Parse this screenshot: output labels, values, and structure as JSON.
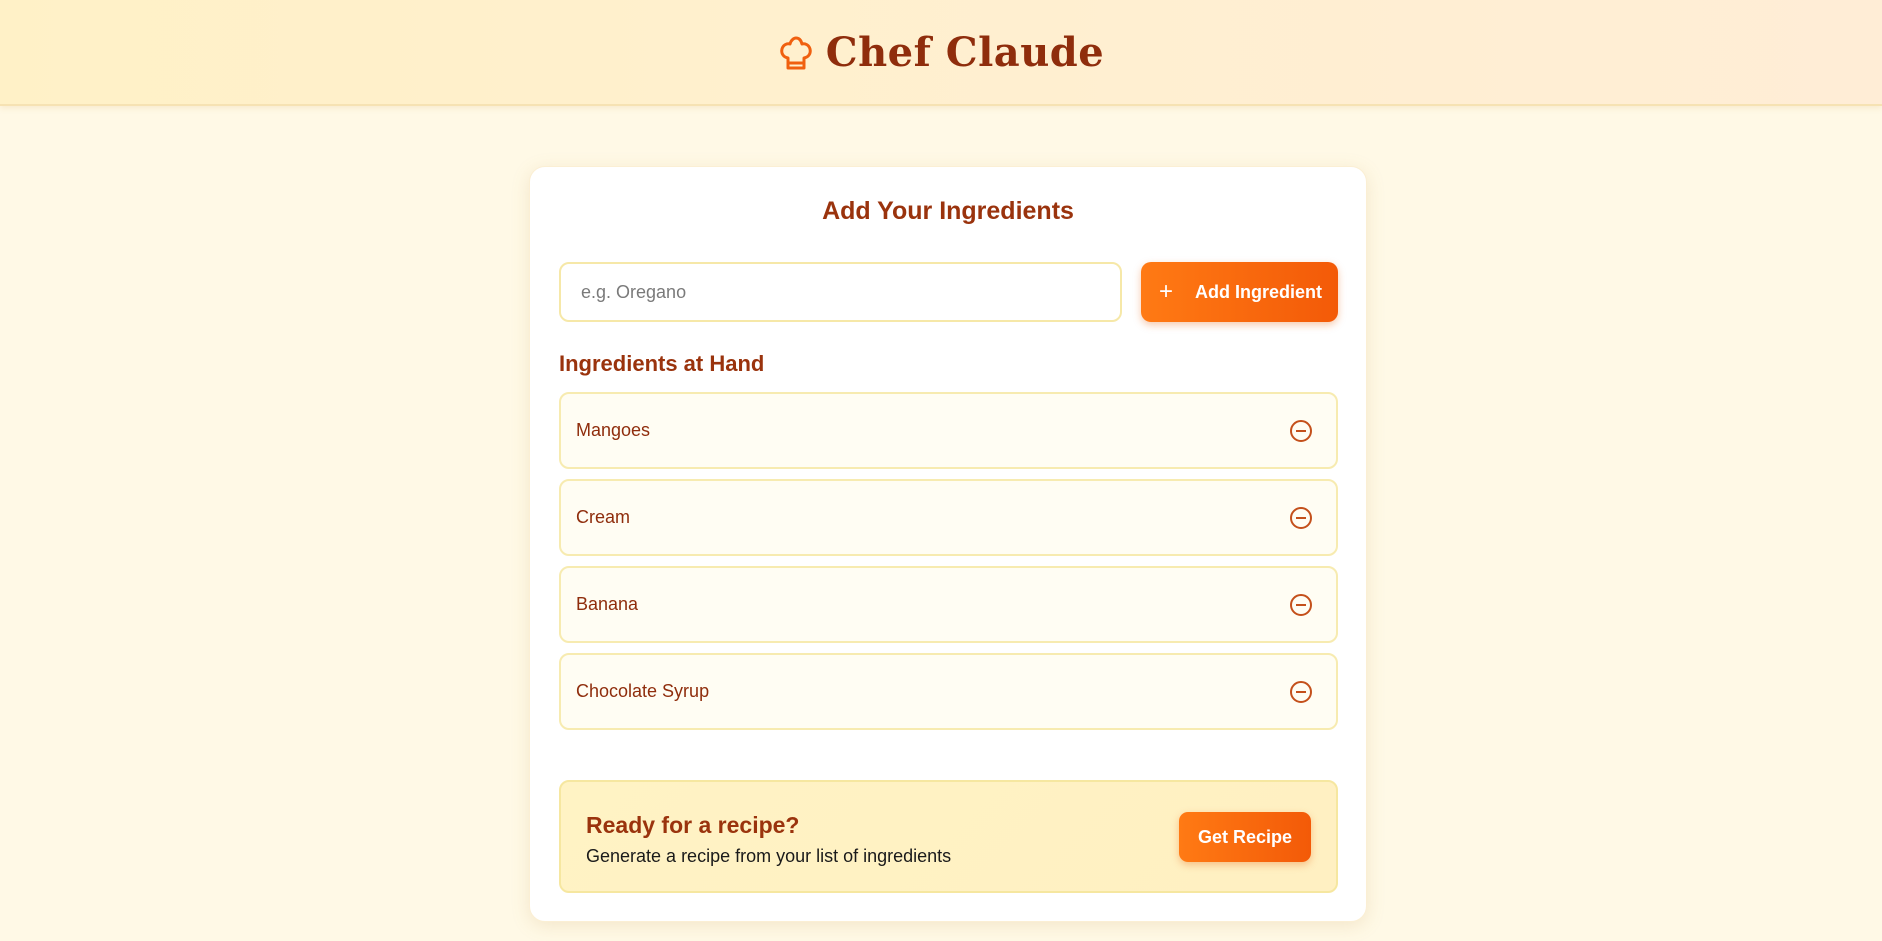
{
  "header": {
    "title": "Chef Claude",
    "icon": "chef-hat-icon"
  },
  "form": {
    "title": "Add Your Ingredients",
    "input_placeholder": "e.g. Oregano",
    "input_value": "",
    "add_button_label": "Add Ingredient",
    "add_button_icon": "plus-icon"
  },
  "ingredients": {
    "title": "Ingredients at Hand",
    "remove_icon": "minus-circle-icon",
    "items": [
      {
        "label": "Mangoes"
      },
      {
        "label": "Cream"
      },
      {
        "label": "Banana"
      },
      {
        "label": "Chocolate Syrup"
      }
    ]
  },
  "cta": {
    "title": "Ready for a recipe?",
    "subtitle": "Generate a recipe from your list of ingredients",
    "button_label": "Get Recipe"
  },
  "colors": {
    "accent": "#f35a08",
    "heading": "#9a330d",
    "page_background": "#fff9e6"
  }
}
